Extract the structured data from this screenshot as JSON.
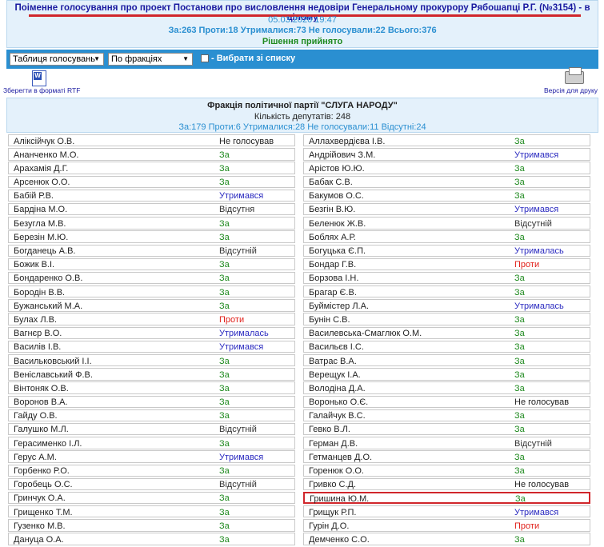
{
  "header": {
    "title": "Поіменне голосування про проект Постанови про висловлення недовіри Генеральному прокурору Рябошапці Р.Г. (№3154) - в цілому",
    "datetime": "05.03.2020 19:47",
    "counts": "За:263 Проти:18 Утрималися:73 Не голосували:22 Всього:376",
    "result": "Рішення прийнято"
  },
  "toolbar": {
    "view_select": "Таблиця голосувань",
    "group_select": "По фракціях",
    "checkbox_label": "- Вибрати зі списку"
  },
  "actions": {
    "rtf_label": "Зберегти в форматі RTF",
    "print_label": "Версія для друку"
  },
  "faction": {
    "name": "Фракція політичної партії \"СЛУГА НАРОДУ\"",
    "count": "Кількість депутатів: 248",
    "stats": "За:179 Проти:6 Утрималися:28 Не голосували:11 Відсутні:24"
  },
  "vote_classes": {
    "За": "vt-for",
    "Утримався": "vt-abst",
    "Утрималась": "vt-abst",
    "Проти": "vt-against",
    "Відсутня": "vt-absent",
    "Відсутній": "vt-absent",
    "Не голосував": "vt-novote"
  },
  "colors": {
    "accent": "#2a8fd1",
    "header_bg": "#e4f1fb",
    "for": "#1f8a1f",
    "abstain": "#2b2bc0",
    "against": "#e0201a",
    "highlight": "#d0262b"
  },
  "rows": [
    {
      "left": {
        "name": "Аліксійчук О.В.",
        "vote": "Не голосував"
      },
      "right": {
        "name": "Аллахвердієва І.В.",
        "vote": "За"
      }
    },
    {
      "left": {
        "name": "Ананченко М.О.",
        "vote": "За"
      },
      "right": {
        "name": "Андрійович З.М.",
        "vote": "Утримався"
      }
    },
    {
      "left": {
        "name": "Арахамія Д.Г.",
        "vote": "За"
      },
      "right": {
        "name": "Арістов Ю.Ю.",
        "vote": "За"
      }
    },
    {
      "left": {
        "name": "Арсенюк О.О.",
        "vote": "За"
      },
      "right": {
        "name": "Бабак С.В.",
        "vote": "За"
      }
    },
    {
      "left": {
        "name": "Бабій Р.В.",
        "vote": "Утримався"
      },
      "right": {
        "name": "Бакумов О.С.",
        "vote": "За"
      }
    },
    {
      "left": {
        "name": "Бардіна М.О.",
        "vote": "Відсутня"
      },
      "right": {
        "name": "Безгін В.Ю.",
        "vote": "Утримався"
      }
    },
    {
      "left": {
        "name": "Безугла М.В.",
        "vote": "За"
      },
      "right": {
        "name": "Беленюк Ж.В.",
        "vote": "Відсутній"
      }
    },
    {
      "left": {
        "name": "Березін М.Ю.",
        "vote": "За"
      },
      "right": {
        "name": "Боблях А.Р.",
        "vote": "За"
      }
    },
    {
      "left": {
        "name": "Богданець А.В.",
        "vote": "Відсутній"
      },
      "right": {
        "name": "Богуцька Є.П.",
        "vote": "Утрималась"
      }
    },
    {
      "left": {
        "name": "Божик В.І.",
        "vote": "За"
      },
      "right": {
        "name": "Бондар Г.В.",
        "vote": "Проти"
      }
    },
    {
      "left": {
        "name": "Бондаренко О.В.",
        "vote": "За"
      },
      "right": {
        "name": "Борзова І.Н.",
        "vote": "За"
      }
    },
    {
      "left": {
        "name": "Бородін В.В.",
        "vote": "За"
      },
      "right": {
        "name": "Брагар Є.В.",
        "vote": "За"
      }
    },
    {
      "left": {
        "name": "Бужанський М.А.",
        "vote": "За"
      },
      "right": {
        "name": "Буймістер Л.А.",
        "vote": "Утрималась"
      }
    },
    {
      "left": {
        "name": "Булах Л.В.",
        "vote": "Проти"
      },
      "right": {
        "name": "Бунін С.В.",
        "vote": "За"
      }
    },
    {
      "left": {
        "name": "Вагнєр В.О.",
        "vote": "Утрималась"
      },
      "right": {
        "name": "Василевська-Смаглюк О.М.",
        "vote": "За"
      }
    },
    {
      "left": {
        "name": "Василів І.В.",
        "vote": "Утримався"
      },
      "right": {
        "name": "Васильєв І.С.",
        "vote": "За"
      }
    },
    {
      "left": {
        "name": "Васильковський І.І.",
        "vote": "За"
      },
      "right": {
        "name": "Ватрас В.А.",
        "vote": "За"
      }
    },
    {
      "left": {
        "name": "Веніславський Ф.В.",
        "vote": "За"
      },
      "right": {
        "name": "Верещук І.А.",
        "vote": "За"
      }
    },
    {
      "left": {
        "name": "Вінтоняк О.В.",
        "vote": "За"
      },
      "right": {
        "name": "Володіна Д.А.",
        "vote": "За"
      }
    },
    {
      "left": {
        "name": "Воронов В.А.",
        "vote": "За"
      },
      "right": {
        "name": "Воронько О.Є.",
        "vote": "Не голосував"
      }
    },
    {
      "left": {
        "name": "Гайду О.В.",
        "vote": "За"
      },
      "right": {
        "name": "Галайчук В.С.",
        "vote": "За"
      }
    },
    {
      "left": {
        "name": "Галушко М.Л.",
        "vote": "Відсутній"
      },
      "right": {
        "name": "Гевко В.Л.",
        "vote": "За"
      }
    },
    {
      "left": {
        "name": "Герасименко І.Л.",
        "vote": "За"
      },
      "right": {
        "name": "Герман Д.В.",
        "vote": "Відсутній"
      }
    },
    {
      "left": {
        "name": "Герус А.М.",
        "vote": "Утримався"
      },
      "right": {
        "name": "Гетманцев Д.О.",
        "vote": "За"
      }
    },
    {
      "left": {
        "name": "Горбенко Р.О.",
        "vote": "За"
      },
      "right": {
        "name": "Горенюк О.О.",
        "vote": "За"
      }
    },
    {
      "left": {
        "name": "Горобець О.С.",
        "vote": "Відсутній"
      },
      "right": {
        "name": "Гривко С.Д.",
        "vote": "Не голосував"
      }
    },
    {
      "left": {
        "name": "Гринчук О.А.",
        "vote": "За"
      },
      "right": {
        "name": "Гришина Ю.М.",
        "vote": "За",
        "highlight": true
      }
    },
    {
      "left": {
        "name": "Грищенко Т.М.",
        "vote": "За"
      },
      "right": {
        "name": "Грищук Р.П.",
        "vote": "Утримався"
      }
    },
    {
      "left": {
        "name": "Гузенко М.В.",
        "vote": "За"
      },
      "right": {
        "name": "Гурін Д.О.",
        "vote": "Проти"
      }
    },
    {
      "left": {
        "name": "Дануца О.А.",
        "vote": "За"
      },
      "right": {
        "name": "Демченко С.О.",
        "vote": "За"
      }
    }
  ]
}
